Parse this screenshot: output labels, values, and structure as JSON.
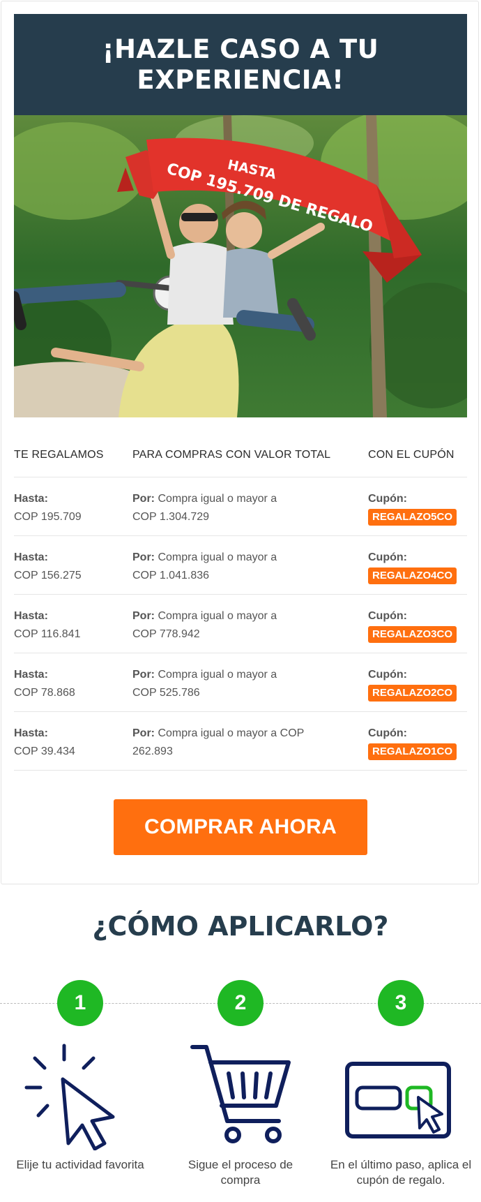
{
  "header": {
    "title_line1": "¡HAZLE CASO A TU",
    "title_line2": "EXPERIENCIA!"
  },
  "banner": {
    "line1": "HASTA",
    "line2": "COP 195.709 DE REGALO"
  },
  "table": {
    "headers": [
      "TE REGALAMOS",
      "PARA COMPRAS CON VALOR TOTAL",
      "CON EL CUPÓN"
    ],
    "rows": [
      {
        "gift_label": "Hasta:",
        "gift_value": "COP 195.709",
        "por_label": "Por:",
        "por_text": "Compra igual o mayor a",
        "por_value": "COP 1.304.729",
        "coupon_label": "Cupón:",
        "coupon": "REGALAZO5CO"
      },
      {
        "gift_label": "Hasta:",
        "gift_value": "COP 156.275",
        "por_label": "Por:",
        "por_text": "Compra igual o mayor a",
        "por_value": "COP 1.041.836",
        "coupon_label": "Cupón:",
        "coupon": "REGALAZO4CO"
      },
      {
        "gift_label": "Hasta:",
        "gift_value": "COP 116.841",
        "por_label": "Por:",
        "por_text": "Compra igual o mayor a",
        "por_value": "COP 778.942",
        "coupon_label": "Cupón:",
        "coupon": "REGALAZO3CO"
      },
      {
        "gift_label": "Hasta:",
        "gift_value": "COP 78.868",
        "por_label": "Por:",
        "por_text": "Compra igual o mayor a",
        "por_value": "COP 525.786",
        "coupon_label": "Cupón:",
        "coupon": "REGALAZO2CO"
      },
      {
        "gift_label": "Hasta:",
        "gift_value": "COP 39.434",
        "por_label": "Por:",
        "por_text": "Compra igual o mayor a COP",
        "por_value": "262.893",
        "coupon_label": "Cupón:",
        "coupon": "REGALAZO1CO"
      }
    ]
  },
  "cta": {
    "label": "COMPRAR AHORA"
  },
  "how": {
    "title": "¿CÓMO APLICARLO?",
    "steps": [
      {
        "number": "1",
        "icon": "cursor-click-icon",
        "line1": "Elije tu actividad favorita",
        "line2": ""
      },
      {
        "number": "2",
        "icon": "shopping-cart-icon",
        "line1": "Sigue el proceso de",
        "line2": "compra"
      },
      {
        "number": "3",
        "icon": "coupon-input-icon",
        "line1": "En el último paso, aplica el",
        "line2": "cupón de regalo."
      }
    ]
  },
  "colors": {
    "header_bg": "#263d4d",
    "accent_orange": "#ff6f0f",
    "step_green": "#1fb824",
    "banner_red": "#e2332b",
    "icon_navy": "#0f1f5c"
  }
}
